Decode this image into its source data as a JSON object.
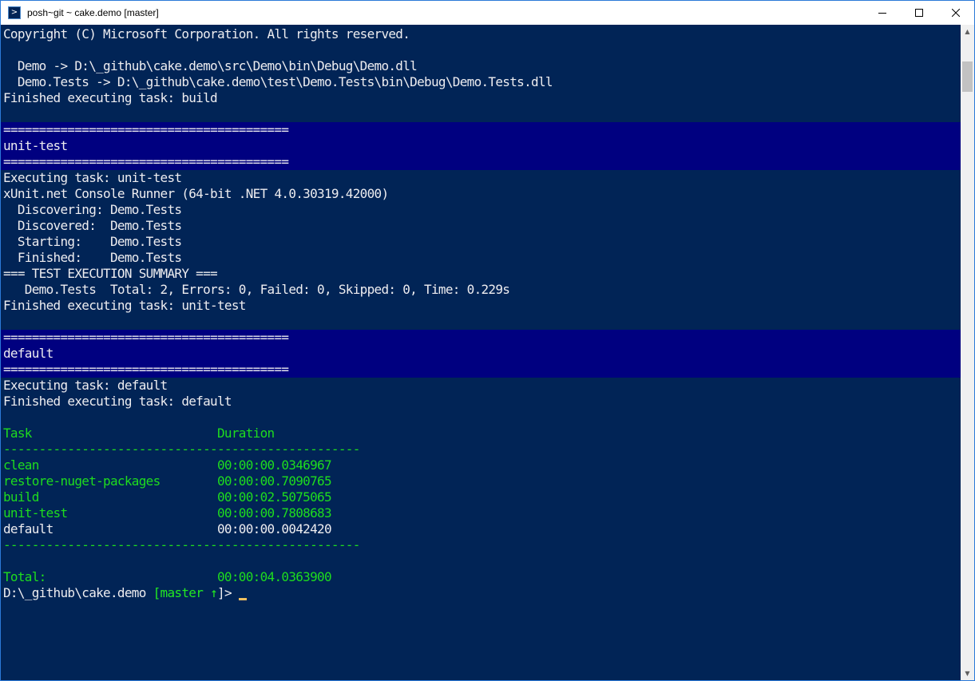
{
  "window": {
    "title": "posh~git ~ cake.demo [master]",
    "icon": "powershell-icon",
    "controls": {
      "minimize": "minimize-icon",
      "maximize": "maximize-icon",
      "close": "close-icon"
    }
  },
  "console": {
    "colors": {
      "background": "#012456",
      "band": "#000080",
      "text": "#eeedf0",
      "green": "#1edc1e"
    },
    "lines": [
      "Copyright (C) Microsoft Corporation. All rights reserved.",
      "",
      "  Demo -> D:\\_github\\cake.demo\\src\\Demo\\bin\\Debug\\Demo.dll",
      "  Demo.Tests -> D:\\_github\\cake.demo\\test\\Demo.Tests\\bin\\Debug\\Demo.Tests.dll",
      "Finished executing task: build",
      "",
      "========================================",
      "unit-test",
      "========================================",
      "Executing task: unit-test",
      "xUnit.net Console Runner (64-bit .NET 4.0.30319.42000)",
      "  Discovering: Demo.Tests",
      "  Discovered:  Demo.Tests",
      "  Starting:    Demo.Tests",
      "  Finished:    Demo.Tests",
      "=== TEST EXECUTION SUMMARY ===",
      "   Demo.Tests  Total: 2, Errors: 0, Failed: 0, Skipped: 0, Time: 0.229s",
      "Finished executing task: unit-test",
      "",
      "========================================",
      "default",
      "========================================",
      "Executing task: default",
      "Finished executing task: default",
      "",
      "Task                          Duration",
      "--------------------------------------------------",
      "clean                         00:00:00.0346967",
      "restore-nuget-packages        00:00:00.7090765",
      "build                         00:00:02.5075065",
      "unit-test                     00:00:00.7808683",
      "default                       00:00:00.0042420",
      "--------------------------------------------------",
      "",
      "Total:                        00:00:04.0363900"
    ],
    "prompt": {
      "path": "D:\\_github\\cake.demo ",
      "branch_open": "[master ",
      "ahead_arrow": "↑",
      "branch_close": "]",
      "suffix": "> "
    }
  }
}
